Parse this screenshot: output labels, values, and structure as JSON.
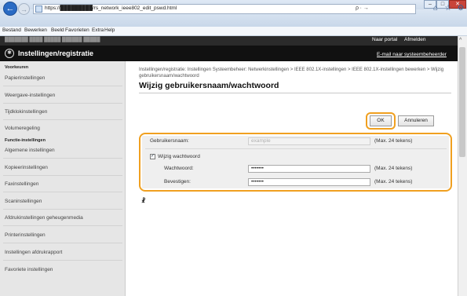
{
  "browser": {
    "url": "https://█████████/rs_network_ieee802_edit_pswd.html",
    "url_actions": "ρ ∙ →",
    "menu": [
      "Bestand",
      "Bewerken",
      "Beeld",
      "Favorieten",
      "Extra",
      "Help"
    ]
  },
  "header": {
    "top_left": "███████ ████ █████ ██████ █████",
    "portal": "Naar portal",
    "logout": "Afmelden",
    "title": "Instellingen/registratie",
    "email": "E-mail naar systeembeheerder"
  },
  "sidebar": {
    "heading_prefs": "Voorkeuren",
    "prefs": [
      "Papierinstellingen",
      "Weergave-instellingen",
      "Tijdklokinstellingen",
      "Volumeregeling"
    ],
    "heading_func": "Functie-instellingen",
    "func": [
      "Algemene instellingen",
      "Kopieerinstellingen",
      "Faxinstellingen",
      "Scaninstellingen",
      "Afdrukinstellingen geheugenmedia",
      "Printerinstellingen",
      "Instellingen afdrukrapport",
      "Favoriete instellingen"
    ]
  },
  "main": {
    "breadcrumb": "Instellingen/registratie: Instellingen Systeembeheer: Netwerkinstellingen > IEEE 802.1X-instellingen > IEEE 802.1X-instellingen bewerken > Wijzig gebruikersnaam/wachtwoord",
    "title": "Wijzig gebruikersnaam/wachtwoord",
    "ok": "OK",
    "cancel": "Annuleren",
    "username_label": "Gebruikersnaam:",
    "username_value": "example",
    "max_note": "(Max. 24 tekens)",
    "change_pw_label": "Wijzig wachtwoord",
    "change_pw_checked": true,
    "password_label": "Wachtwoord:",
    "password_value": "•••••••",
    "confirm_label": "Bevestigen:",
    "confirm_value": "•••••••",
    "fn_marker": "☧"
  }
}
